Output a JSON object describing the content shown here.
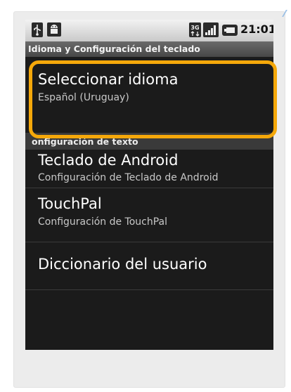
{
  "status_bar": {
    "time": "21:01",
    "network_label": "3G",
    "icons": [
      "usb-icon",
      "android-icon",
      "network-3g-icon",
      "signal-icon",
      "battery-icon"
    ]
  },
  "title_bar": {
    "title": "Idioma y Configuración del teclado"
  },
  "items": [
    {
      "title": "Seleccionar idioma",
      "subtitle": "Español (Uruguay)"
    },
    {
      "title": "Teclado de Android",
      "subtitle": "Configuración de Teclado de Android"
    },
    {
      "title": "TouchPal",
      "subtitle": "Configuración de TouchPal"
    },
    {
      "title": "Diccionario del usuario"
    }
  ],
  "section_header": {
    "label": "onfiguración de texto"
  },
  "colors": {
    "highlight": "#f5a80a",
    "screen_background": "#1b1b1b",
    "statusbar_background": "#dcdcdc"
  }
}
